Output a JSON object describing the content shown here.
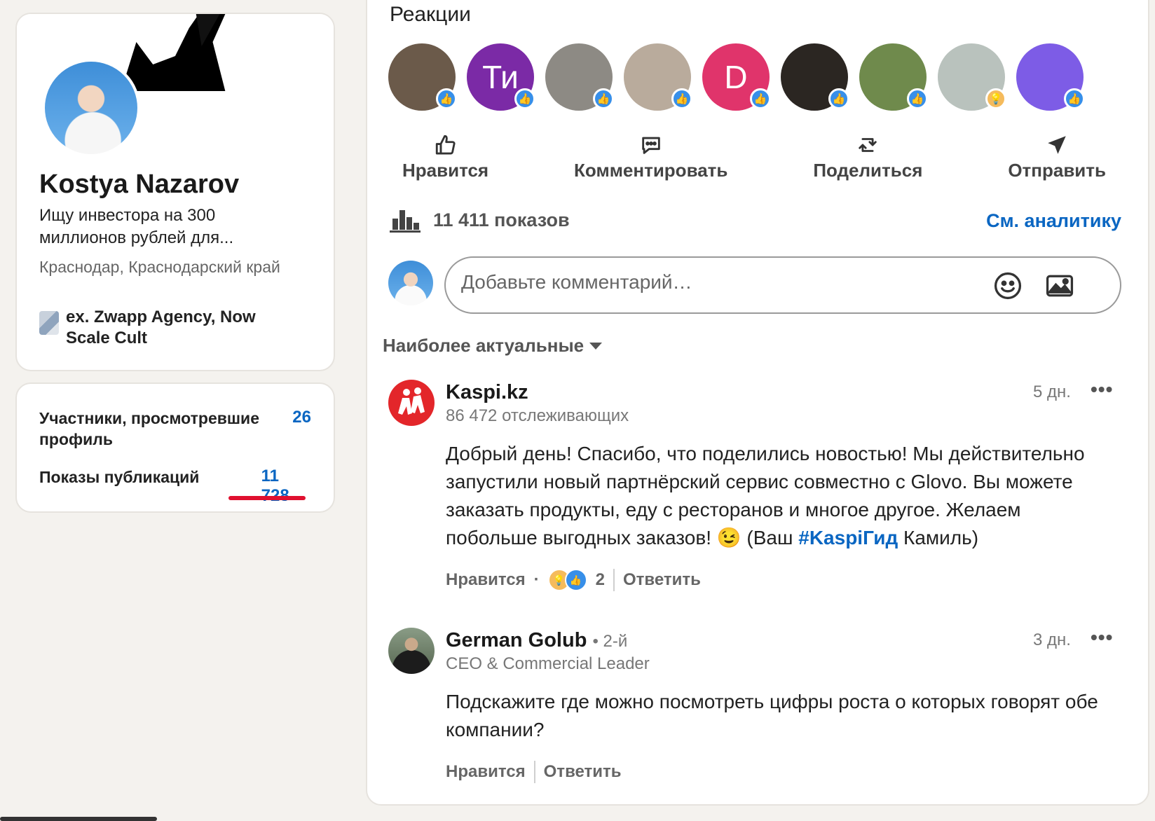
{
  "profile": {
    "name": "Kostya Nazarov",
    "headline": "Ищу инвестора на 300 миллионов рублей для...",
    "location": "Краснодар, Краснодарский край",
    "company": "ex. Zwapp Agency, Now Scale Cult"
  },
  "stats": {
    "viewers_label": "Участники, просмотревшие профиль",
    "viewers_value": "26",
    "impressions_label": "Показы публикаций",
    "impressions_value": "11 728"
  },
  "post": {
    "reactions_title": "Реакции",
    "reactors": [
      {
        "initials": "",
        "color": "#6b5a4a",
        "reaction": "like"
      },
      {
        "initials": "Ти",
        "color": "#7b2aa6",
        "reaction": "like"
      },
      {
        "initials": "",
        "color": "#8d8a84",
        "reaction": "like"
      },
      {
        "initials": "",
        "color": "#b9ab9c",
        "reaction": "like"
      },
      {
        "initials": "D",
        "color": "#e0346b",
        "reaction": "like"
      },
      {
        "initials": "",
        "color": "#2b2622",
        "reaction": "like"
      },
      {
        "initials": "",
        "color": "#6f8a4c",
        "reaction": "like"
      },
      {
        "initials": "",
        "color": "#b9c2bd",
        "reaction": "insightful"
      },
      {
        "initials": "",
        "color": "#7d5ce6",
        "reaction": "like"
      }
    ],
    "actions": {
      "like": "Нравится",
      "comment": "Комментировать",
      "share": "Поделиться",
      "send": "Отправить"
    },
    "views": "11 411 показов",
    "analytics_link": "См. аналитику",
    "comment_placeholder": "Добавьте комментарий…",
    "sort_label": "Наиболее актуальные"
  },
  "comments": [
    {
      "author": "Kaspi.kz",
      "subtitle": "86 472 отслеживающих",
      "time": "5 дн.",
      "text_before": "Добрый день! Спасибо, что поделились новостью! Мы действительно запустили новый партнёрский сервис совместно с Glovo. Вы можете заказать продукты, еду с ресторанов и многое другое. Желаем побольше выгодных заказов! 😉 (Ваш ",
      "hashtag": "#KaspiГид",
      "text_after": " Камиль)",
      "like_label": "Нравится",
      "reaction_count": "2",
      "reply_label": "Ответить"
    },
    {
      "author": "German Golub",
      "degree": "• 2-й",
      "subtitle": "CEO & Commercial Leader",
      "time": "3 дн.",
      "text": "Подскажите где можно посмотреть цифры роста о которых говорят обе компании?",
      "like_label": "Нравится",
      "reply_label": "Ответить"
    }
  ],
  "colors": {
    "accent": "#0a66c2",
    "underline": "#e0102f",
    "like_badge": "#378fe9",
    "kaspi_red": "#e3262a"
  }
}
